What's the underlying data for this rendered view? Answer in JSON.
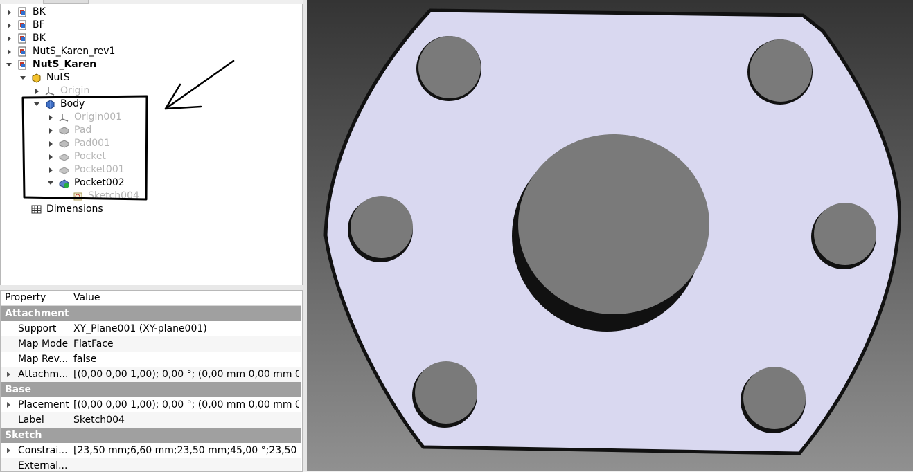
{
  "tree": {
    "items": [
      {
        "label": "BK",
        "state": "normal",
        "expand": "right",
        "icon": "document-icon"
      },
      {
        "label": "BF",
        "state": "normal",
        "expand": "right",
        "icon": "document-icon"
      },
      {
        "label": "BK",
        "state": "normal",
        "expand": "right",
        "icon": "document-icon"
      },
      {
        "label": "NutS_Karen_rev1",
        "state": "normal",
        "expand": "right",
        "icon": "document-icon"
      },
      {
        "label": "NutS_Karen",
        "state": "bold",
        "expand": "down",
        "icon": "document-icon"
      },
      {
        "label": "NutS",
        "state": "normal",
        "expand": "down",
        "icon": "part-icon"
      },
      {
        "label": "Origin",
        "state": "dim",
        "expand": "right",
        "icon": "origin-icon"
      },
      {
        "label": "Body",
        "state": "normal",
        "expand": "down",
        "icon": "body-icon"
      },
      {
        "label": "Origin001",
        "state": "dim",
        "expand": "right",
        "icon": "origin-icon"
      },
      {
        "label": "Pad",
        "state": "dim",
        "expand": "right",
        "icon": "pad-icon"
      },
      {
        "label": "Pad001",
        "state": "dim",
        "expand": "right",
        "icon": "pad-icon"
      },
      {
        "label": "Pocket",
        "state": "dim",
        "expand": "right",
        "icon": "pocket-icon"
      },
      {
        "label": "Pocket001",
        "state": "dim",
        "expand": "right",
        "icon": "pocket-icon"
      },
      {
        "label": "Pocket002",
        "state": "normal",
        "expand": "down",
        "icon": "pocket-active-icon"
      },
      {
        "label": "Sketch004",
        "state": "dim",
        "expand": "none",
        "icon": "sketch-icon"
      },
      {
        "label": "Dimensions",
        "state": "normal",
        "expand": "none",
        "icon": "spreadsheet-icon"
      }
    ]
  },
  "props": {
    "col_property": "Property",
    "col_value": "Value",
    "rows": [
      {
        "type": "group",
        "name": "Attachment"
      },
      {
        "type": "prop",
        "name": "Support",
        "value": "XY_Plane001 (XY-plane001)",
        "expandable": false
      },
      {
        "type": "prop",
        "name": "Map Mode",
        "value": "FlatFace",
        "expandable": false
      },
      {
        "type": "prop",
        "name": "Map Rev...",
        "value": "false",
        "expandable": false
      },
      {
        "type": "prop",
        "name": "Attachm...",
        "value": "[(0,00 0,00 1,00); 0,00 °; (0,00 mm  0,00 mm  0,...",
        "expandable": true
      },
      {
        "type": "group",
        "name": "Base"
      },
      {
        "type": "prop",
        "name": "Placement",
        "value": "[(0,00 0,00 1,00); 0,00 °; (0,00 mm  0,00 mm  0,...",
        "expandable": true
      },
      {
        "type": "prop",
        "name": "Label",
        "value": "Sketch004",
        "expandable": false
      },
      {
        "type": "group",
        "name": "Sketch"
      },
      {
        "type": "prop",
        "name": "Constrai...",
        "value": "[23,50 mm;6,60 mm;23,50 mm;45,00 °;23,50 ...",
        "expandable": true
      },
      {
        "type": "prop",
        "name": "External...",
        "value": "",
        "expandable": false
      }
    ]
  },
  "colors": {
    "plate_fill": "#d9d8f0",
    "hole_fill": "#7a7a7a",
    "outline": "#111111",
    "group_bg": "#a0a0a0",
    "dim_text": "#b4b4b4"
  }
}
